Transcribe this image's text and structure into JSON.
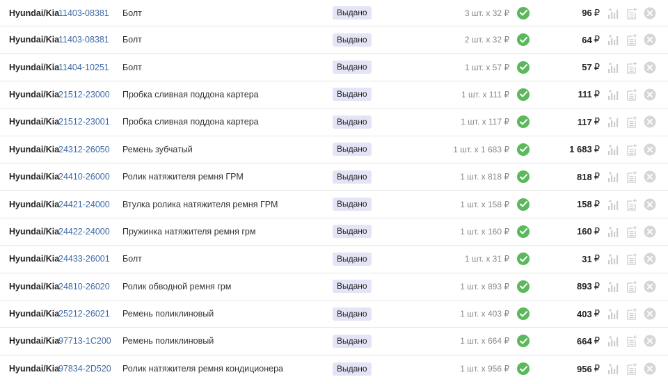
{
  "colors": {
    "article_link": "#3d6aa8",
    "status_badge_bg": "#e4e4f7",
    "check_green": "#5cb85c",
    "icon_gray": "#cccccc"
  },
  "icons": {
    "status": "check-circle-icon",
    "stats": "bar-chart-icon",
    "note": "note-add-icon",
    "delete": "close-circle-icon"
  },
  "rows": [
    {
      "brand": "Hyundai/Kia",
      "article": "11403-08381",
      "description": "Болт",
      "status": "Выдано",
      "quantity": "3 шт. х 32 ₽",
      "price": "96",
      "currency": "₽"
    },
    {
      "brand": "Hyundai/Kia",
      "article": "11403-08381",
      "description": "Болт",
      "status": "Выдано",
      "quantity": "2 шт. х 32 ₽",
      "price": "64",
      "currency": "₽"
    },
    {
      "brand": "Hyundai/Kia",
      "article": "11404-10251",
      "description": "Болт",
      "status": "Выдано",
      "quantity": "1 шт. х 57 ₽",
      "price": "57",
      "currency": "₽"
    },
    {
      "brand": "Hyundai/Kia",
      "article": "21512-23000",
      "description": "Пробка сливная поддона картера",
      "status": "Выдано",
      "quantity": "1 шт. х 111 ₽",
      "price": "111",
      "currency": "₽"
    },
    {
      "brand": "Hyundai/Kia",
      "article": "21512-23001",
      "description": "Пробка сливная поддона картера",
      "status": "Выдано",
      "quantity": "1 шт. х 117 ₽",
      "price": "117",
      "currency": "₽"
    },
    {
      "brand": "Hyundai/Kia",
      "article": "24312-26050",
      "description": "Ремень зубчатый",
      "status": "Выдано",
      "quantity": "1 шт. х 1 683 ₽",
      "price": "1 683",
      "currency": "₽"
    },
    {
      "brand": "Hyundai/Kia",
      "article": "24410-26000",
      "description": "Ролик натяжителя ремня ГРМ",
      "status": "Выдано",
      "quantity": "1 шт. х 818 ₽",
      "price": "818",
      "currency": "₽"
    },
    {
      "brand": "Hyundai/Kia",
      "article": "24421-24000",
      "description": "Втулка ролика натяжителя ремня ГРМ",
      "status": "Выдано",
      "quantity": "1 шт. х 158 ₽",
      "price": "158",
      "currency": "₽"
    },
    {
      "brand": "Hyundai/Kia",
      "article": "24422-24000",
      "description": "Пружинка натяжителя ремня грм",
      "status": "Выдано",
      "quantity": "1 шт. х 160 ₽",
      "price": "160",
      "currency": "₽"
    },
    {
      "brand": "Hyundai/Kia",
      "article": "24433-26001",
      "description": "Болт",
      "status": "Выдано",
      "quantity": "1 шт. х 31 ₽",
      "price": "31",
      "currency": "₽"
    },
    {
      "brand": "Hyundai/Kia",
      "article": "24810-26020",
      "description": "Ролик обводной ремня грм",
      "status": "Выдано",
      "quantity": "1 шт. х 893 ₽",
      "price": "893",
      "currency": "₽"
    },
    {
      "brand": "Hyundai/Kia",
      "article": "25212-26021",
      "description": "Ремень поликлиновый",
      "status": "Выдано",
      "quantity": "1 шт. х 403 ₽",
      "price": "403",
      "currency": "₽"
    },
    {
      "brand": "Hyundai/Kia",
      "article": "97713-1C200",
      "description": "Ремень поликлиновый",
      "status": "Выдано",
      "quantity": "1 шт. х 664 ₽",
      "price": "664",
      "currency": "₽"
    },
    {
      "brand": "Hyundai/Kia",
      "article": "97834-2D520",
      "description": "Ролик натяжителя ремня кондиционера",
      "status": "Выдано",
      "quantity": "1 шт. х 956 ₽",
      "price": "956",
      "currency": "₽"
    }
  ]
}
